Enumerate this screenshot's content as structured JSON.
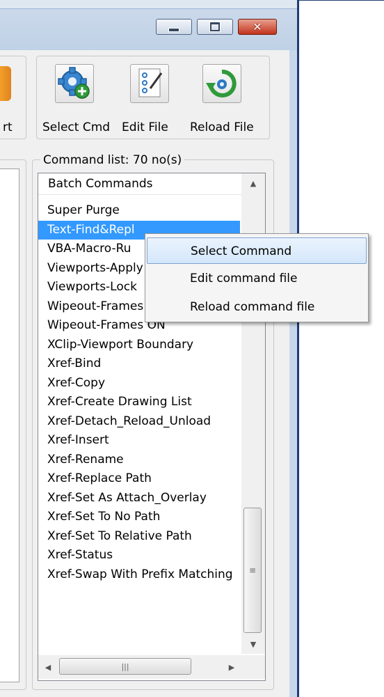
{
  "toolbar": {
    "left_partial_label": "rt",
    "buttons": [
      {
        "label": "Select Cmd",
        "icon": "gear-add-icon"
      },
      {
        "label": "Edit File",
        "icon": "edit-file-icon"
      },
      {
        "label": "Reload File",
        "icon": "reload-icon"
      }
    ]
  },
  "command_list": {
    "group_title": "Command list: 70 no(s)",
    "header": "Batch Commands",
    "selected_index": 1,
    "items": [
      "Super Purge",
      "Text-Find&Repl",
      "VBA-Macro-Ru",
      "Viewports-Apply",
      "Viewports-Lock",
      "Wipeout-Frames OFF",
      "Wipeout-Frames ON",
      "XClip-Viewport Boundary",
      "Xref-Bind",
      "Xref-Copy",
      "Xref-Create Drawing List",
      "Xref-Detach_Reload_Unload",
      "Xref-Insert",
      "Xref-Rename",
      "Xref-Replace Path",
      "Xref-Set As Attach_Overlay",
      "Xref-Set To No Path",
      "Xref-Set To Relative Path",
      "Xref-Status",
      "Xref-Swap With Prefix Matching"
    ]
  },
  "context_menu": {
    "items": [
      {
        "label": "Select Command",
        "highlighted": true
      },
      {
        "label": "Edit command file",
        "highlighted": false
      },
      {
        "label": "Reload command file",
        "highlighted": false
      }
    ]
  },
  "colors": {
    "selection": "#3399ff",
    "window_frame": "#1f3d74",
    "close_button": "#c2321c"
  }
}
